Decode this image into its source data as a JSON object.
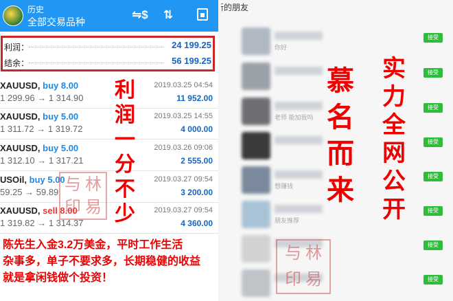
{
  "header": {
    "title": "历史",
    "subtitle": "全部交易品种"
  },
  "summary": {
    "profit_label": "利润：",
    "profit_value": "24 199.25",
    "balance_label": "结余：",
    "balance_value": "56 199.25"
  },
  "trades": [
    {
      "symbol": "XAUUSD,",
      "side": "buy 8.00",
      "prices": "1 299.96 → 1 314.90",
      "datetime": "2019.03.25 04:54",
      "profit": "11 952.00"
    },
    {
      "symbol": "XAUUSD,",
      "side": "buy 5.00",
      "prices": "1 311.72 → 1 319.72",
      "datetime": "2019.03.25 14:55",
      "profit": "4 000.00"
    },
    {
      "symbol": "XAUUSD,",
      "side": "buy 5.00",
      "prices": "1 312.10 → 1 317.21",
      "datetime": "2019.03.26 09:06",
      "profit": "2 555.00"
    },
    {
      "symbol": "USOil,",
      "side": "buy 5.00",
      "prices": "59.25 → 59.89",
      "datetime": "2019.03.27 09:54",
      "profit": "3 200.00"
    },
    {
      "symbol": "XAUUSD,",
      "side": "sell 8.00",
      "prices": "1 319.82 → 1 314.37",
      "datetime": "2019.03.27 09:54",
      "profit": "4 360.00"
    }
  ],
  "overlay": {
    "vertical_left": [
      "利",
      "润",
      "一",
      "分",
      "不",
      "少"
    ],
    "bottom_line1": "陈先生入金3.2万美金，平时工作生活",
    "bottom_line2": "杂事多，单子不要求多，长期稳健的收益",
    "bottom_line3": "就是拿闲钱做个投资！",
    "col_a": [
      "慕",
      "名",
      "而",
      "来"
    ],
    "col_b": [
      "实",
      "力",
      "全",
      "网",
      "公",
      "开"
    ]
  },
  "seal": [
    "与",
    "林",
    "印",
    "易"
  ],
  "right_panel": {
    "header": "新的朋友",
    "accept_label": "接受",
    "friends": [
      {
        "msg": "你好"
      },
      {
        "msg": ""
      },
      {
        "msg": "老师 能加我吗"
      },
      {
        "msg": ""
      },
      {
        "msg": "想赚钱"
      },
      {
        "msg": "朋友推荐"
      },
      {
        "msg": ""
      },
      {
        "msg": ""
      }
    ]
  },
  "colors": {
    "topbar": "#2196f3",
    "highlight_red": "#e00000",
    "accept_green": "#2ebd3a",
    "value_blue": "#1565c0"
  }
}
